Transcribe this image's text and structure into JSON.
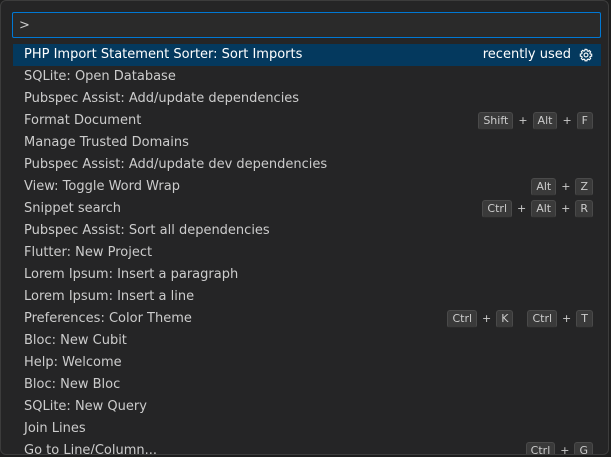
{
  "quick_open": {
    "input_value": ">",
    "items": [
      {
        "label": "PHP Import Statement Sorter: Sort Imports",
        "badge": "recently used",
        "selected": true,
        "keys": []
      },
      {
        "label": "SQLite: Open Database",
        "keys": []
      },
      {
        "label": "Pubspec Assist: Add/update dependencies",
        "keys": []
      },
      {
        "label": "Format Document",
        "keys": [
          [
            "Shift",
            "Alt",
            "F"
          ]
        ]
      },
      {
        "label": "Manage Trusted Domains",
        "keys": []
      },
      {
        "label": "Pubspec Assist: Add/update dev dependencies",
        "keys": []
      },
      {
        "label": "View: Toggle Word Wrap",
        "keys": [
          [
            "Alt",
            "Z"
          ]
        ]
      },
      {
        "label": "Snippet search",
        "keys": [
          [
            "Ctrl",
            "Alt",
            "R"
          ]
        ]
      },
      {
        "label": "Pubspec Assist: Sort all dependencies",
        "keys": []
      },
      {
        "label": "Flutter: New Project",
        "keys": []
      },
      {
        "label": "Lorem Ipsum: Insert a paragraph",
        "keys": []
      },
      {
        "label": "Lorem Ipsum: Insert a line",
        "keys": []
      },
      {
        "label": "Preferences: Color Theme",
        "keys": [
          [
            "Ctrl",
            "K"
          ],
          [
            "Ctrl",
            "T"
          ]
        ]
      },
      {
        "label": "Bloc: New Cubit",
        "keys": []
      },
      {
        "label": "Help: Welcome",
        "keys": []
      },
      {
        "label": "Bloc: New Bloc",
        "keys": []
      },
      {
        "label": "SQLite: New Query",
        "keys": []
      },
      {
        "label": "Join Lines",
        "keys": []
      },
      {
        "label": "Go to Line/Column...",
        "keys": [
          [
            "Ctrl",
            "G"
          ]
        ]
      }
    ]
  },
  "icons": {
    "settings": "gear-icon"
  },
  "colors": {
    "selection": "#04395e",
    "focus_border": "#0078d4",
    "background": "#252526"
  }
}
